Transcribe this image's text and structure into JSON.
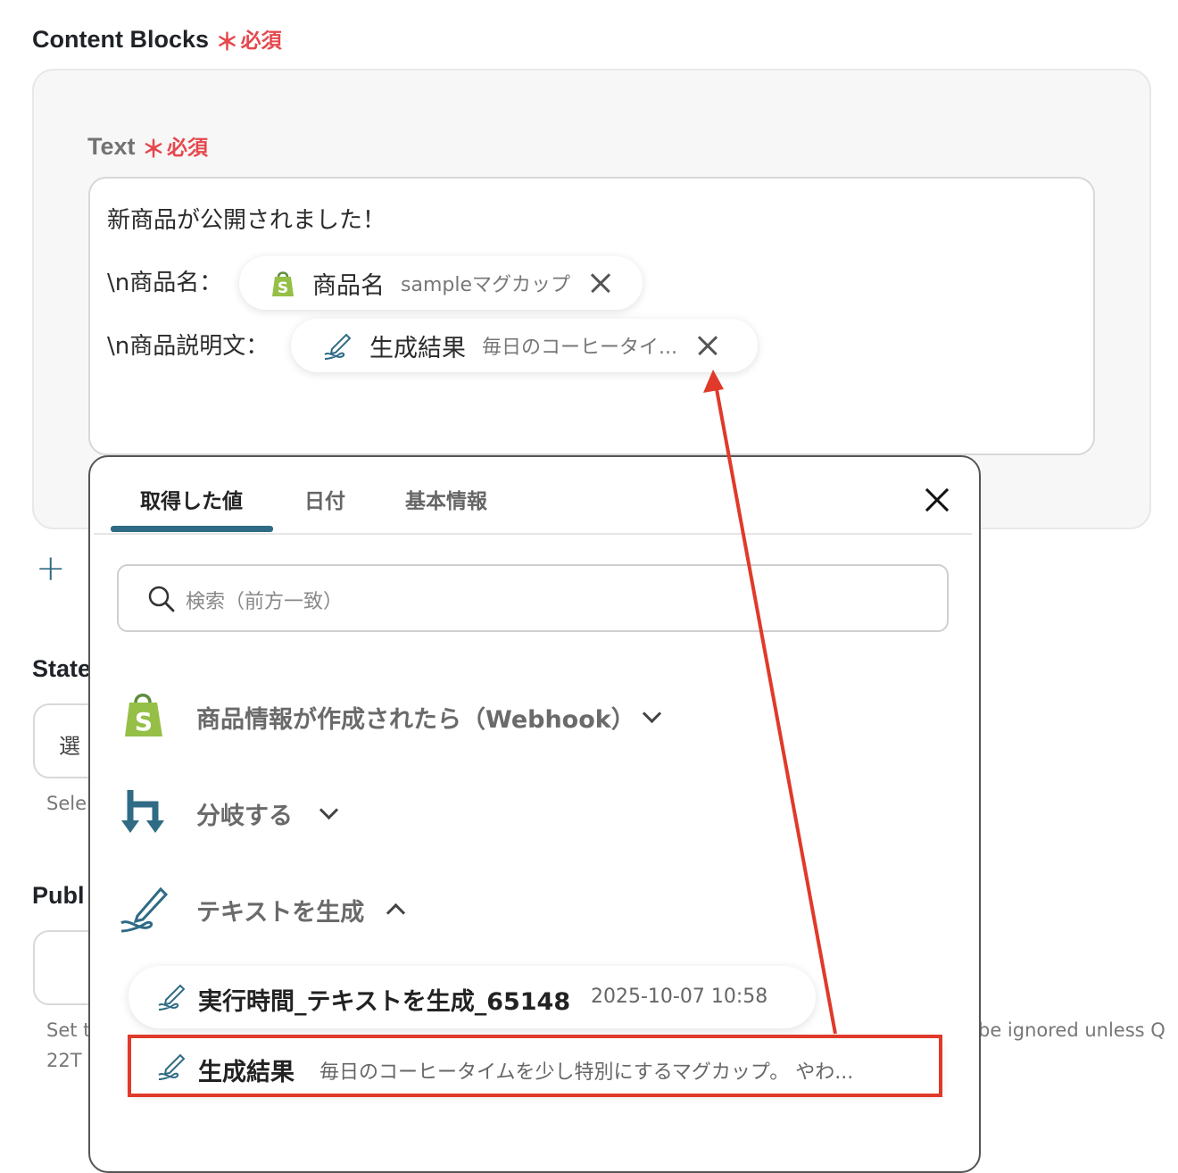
{
  "content_blocks": {
    "title": "Content Blocks",
    "required_label": "必須",
    "required_mark": "＊"
  },
  "text_field": {
    "label": "Text",
    "required_label": "必須",
    "required_mark": "＊",
    "line1": "新商品が公開されました！",
    "line2_prefix": "\\n商品名：",
    "line3_prefix": "\\n商品説明文：",
    "chip1": {
      "icon": "shopify-icon",
      "name": "商品名",
      "value": "sampleマグカップ"
    },
    "chip2": {
      "icon": "ai-pen-icon",
      "name": "生成結果",
      "value": "毎日のコーヒータイ..."
    }
  },
  "background": {
    "add_icon": "+",
    "state_label_partial": "State",
    "select_partial": "選",
    "select_help_partial": "Sele",
    "publish_label_partial": "Publ",
    "publish_help_partial_1": "Set t",
    "publish_help_partial_2": "22T",
    "right_help_partial": "be ignored unless Q"
  },
  "dropdown": {
    "tabs": [
      "取得した値",
      "日付",
      "基本情報"
    ],
    "active_tab": 0,
    "search_placeholder": "検索（前方一致）",
    "groups": [
      {
        "icon": "shopify-icon",
        "label": "商品情報が作成されたら（Webhook）",
        "expanded": false
      },
      {
        "icon": "branch-icon",
        "label": "分岐する",
        "expanded": false
      },
      {
        "icon": "ai-pen-icon",
        "label": "テキストを生成",
        "expanded": true
      }
    ],
    "items": [
      {
        "icon": "ai-pen-icon",
        "name": "実行時間_テキストを生成_65148",
        "value": "2025-10-07 10:58"
      },
      {
        "icon": "ai-pen-icon",
        "name": "生成結果",
        "value": "毎日のコーヒータイムを少し特別にするマグカップ。 やわ..."
      }
    ]
  },
  "colors": {
    "required": "#e5484d",
    "active_tab_underline": "#2f6b85",
    "highlight": "#e03a2a",
    "shopify_green": "#95bf47",
    "branch_teal": "#2f6b85"
  }
}
